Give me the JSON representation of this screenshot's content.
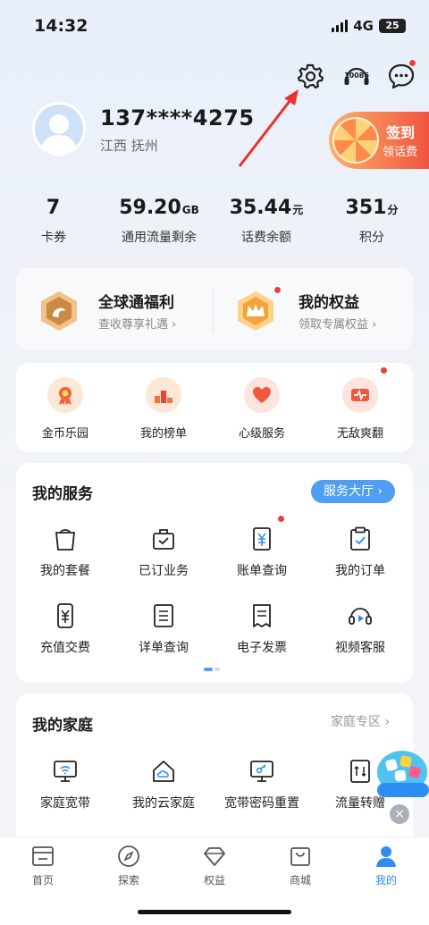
{
  "status_bar": {
    "time": "14:32",
    "network": "4G",
    "battery": "25"
  },
  "top_icons": [
    "gear-icon",
    "10086-icon",
    "chat-icon"
  ],
  "hotline": "10086",
  "user": {
    "phone": "137****4275",
    "location": "江西 抚州"
  },
  "checkin": {
    "line1": "签到",
    "line2": "领话费"
  },
  "stats": [
    {
      "value": "7",
      "unit": "",
      "label": "卡券"
    },
    {
      "value": "59.20",
      "unit": "GB",
      "label": "通用流量剩余"
    },
    {
      "value": "35.44",
      "unit": "元",
      "label": "话费余额"
    },
    {
      "value": "351",
      "unit": "分",
      "label": "积分"
    }
  ],
  "benefits": [
    {
      "title": "全球通福利",
      "subtitle": "查收尊享礼遇 ›"
    },
    {
      "title": "我的权益",
      "subtitle": "领取专属权益 ›"
    }
  ],
  "quick_items": [
    "金币乐园",
    "我的榜单",
    "心级服务",
    "无敌爽翻"
  ],
  "services": {
    "title": "我的服务",
    "hall_button": "服务大厅 ›",
    "items": [
      "我的套餐",
      "已订业务",
      "账单查询",
      "我的订单",
      "充值交费",
      "详单查询",
      "电子发票",
      "视频客服"
    ]
  },
  "family": {
    "title": "我的家庭",
    "zone_link": "家庭专区 ›",
    "items": [
      "家庭宽带",
      "我的云家庭",
      "宽带密码重置",
      "流量转赠"
    ]
  },
  "float_close": "×",
  "tabs": [
    {
      "label": "首页",
      "active": false
    },
    {
      "label": "探索",
      "active": false
    },
    {
      "label": "权益",
      "active": false
    },
    {
      "label": "商城",
      "active": false
    },
    {
      "label": "我的",
      "active": true
    }
  ],
  "colors": {
    "accent": "#2f8cf0",
    "badge": "#e8423a",
    "annotation_arrow": "#e8332a"
  }
}
